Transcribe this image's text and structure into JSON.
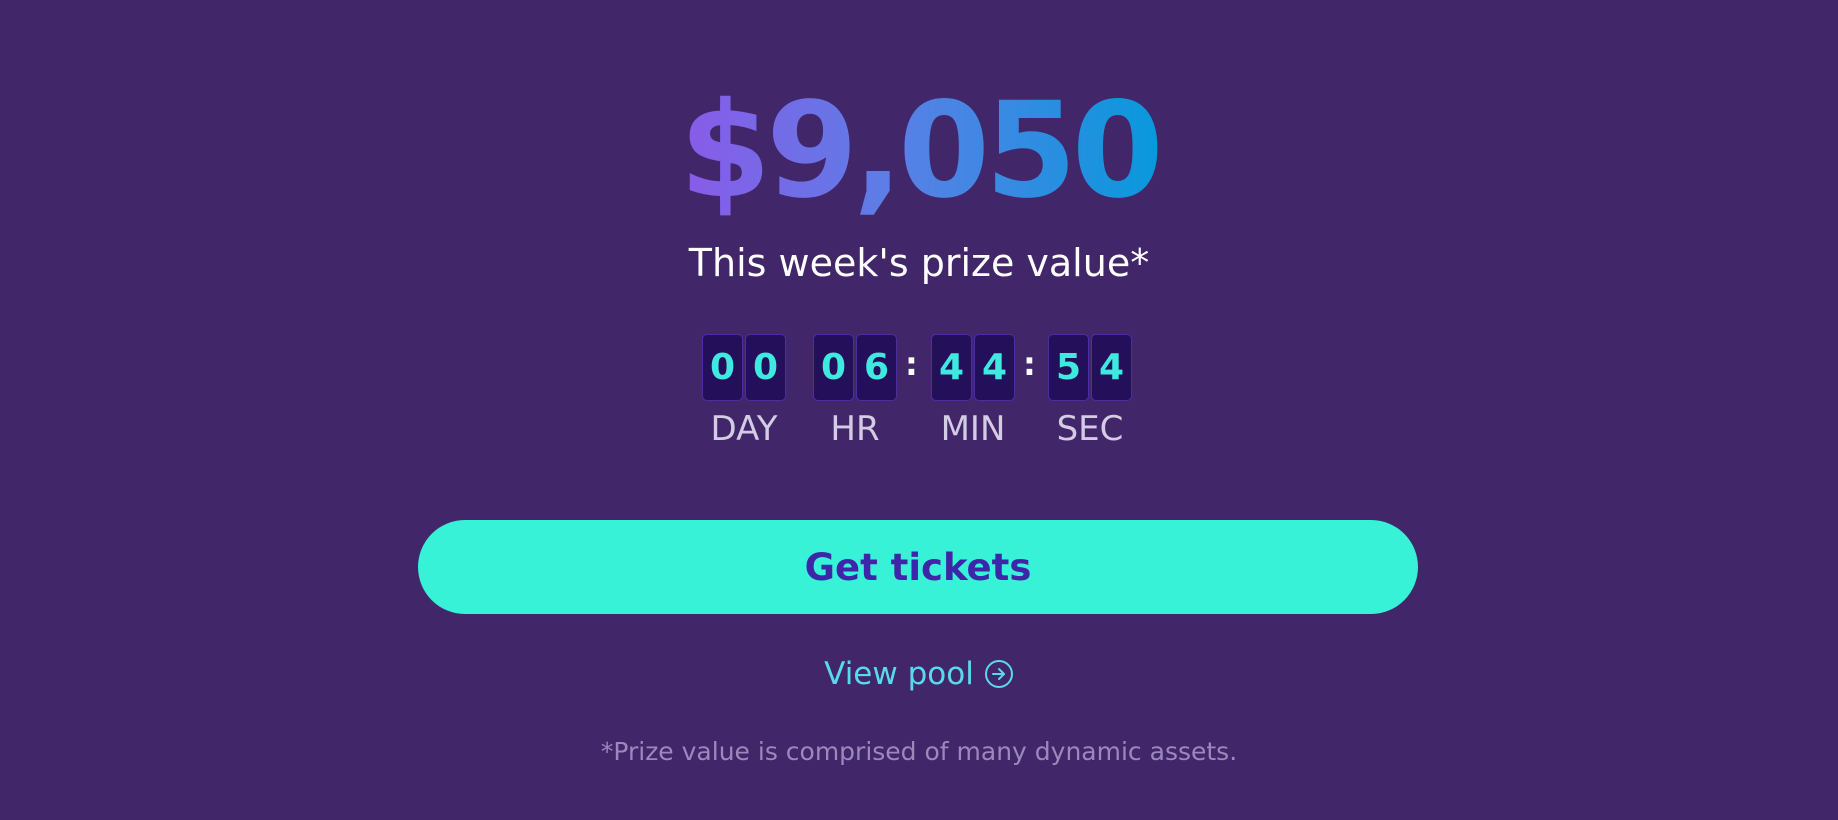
{
  "prize": {
    "amount": "$9,050",
    "label": "This week's prize value*"
  },
  "countdown": {
    "day": {
      "digits": [
        "0",
        "0"
      ],
      "label": "DAY"
    },
    "hour": {
      "digits": [
        "0",
        "6"
      ],
      "label": "HR"
    },
    "min": {
      "digits": [
        "4",
        "4"
      ],
      "label": "MIN"
    },
    "sec": {
      "digits": [
        "5",
        "4"
      ],
      "label": "SEC"
    },
    "separator": ":"
  },
  "cta": {
    "label": "Get tickets"
  },
  "view_pool": {
    "label": "View pool",
    "icon": "arrow-right-circle-icon"
  },
  "footnote": "*Prize value is comprised of many dynamic assets.",
  "colors": {
    "background": "#42266a",
    "accent": "#37f2d6",
    "button_text": "#3d26a8",
    "digit_text": "#3fe9e0",
    "link": "#5ad9ee"
  }
}
